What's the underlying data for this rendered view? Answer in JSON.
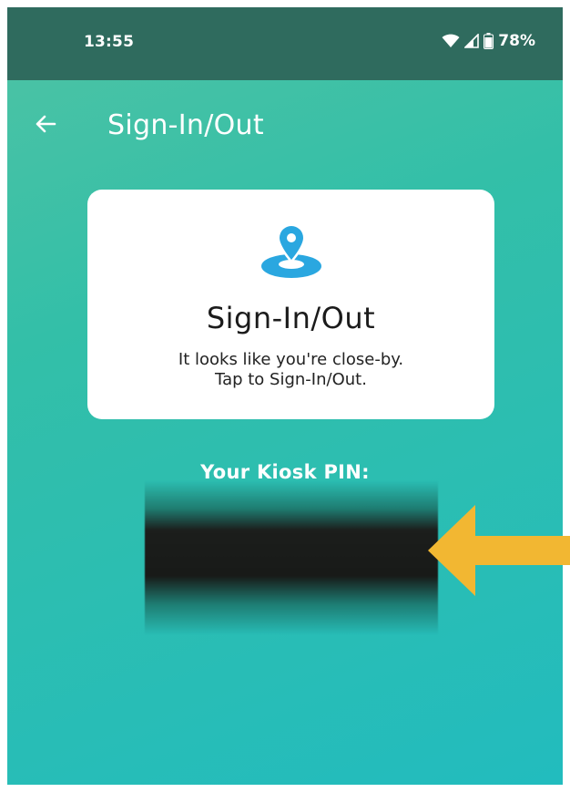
{
  "status_bar": {
    "time": "13:55",
    "battery_percent": "78%",
    "icons": [
      "wifi-icon",
      "cellular-signal-icon",
      "battery-icon"
    ]
  },
  "app_bar": {
    "title": "Sign-In/Out",
    "back_icon": "arrow-left-icon"
  },
  "card": {
    "icon": "location-pin-icon",
    "title": "Sign-In/Out",
    "subtitle_line1": "It looks like you're close-by.",
    "subtitle_line2": "Tap to Sign-In/Out."
  },
  "kiosk_pin": {
    "label": "Your Kiosk PIN:",
    "value": ""
  },
  "annotation": {
    "icon": "pointer-arrow-icon",
    "color": "#f2b732"
  },
  "colors": {
    "status_bar": "#2f6b5e",
    "background_top": "#4fc3a4",
    "background_bottom": "#22bcbe",
    "accent_blue": "#2aa7e0"
  }
}
